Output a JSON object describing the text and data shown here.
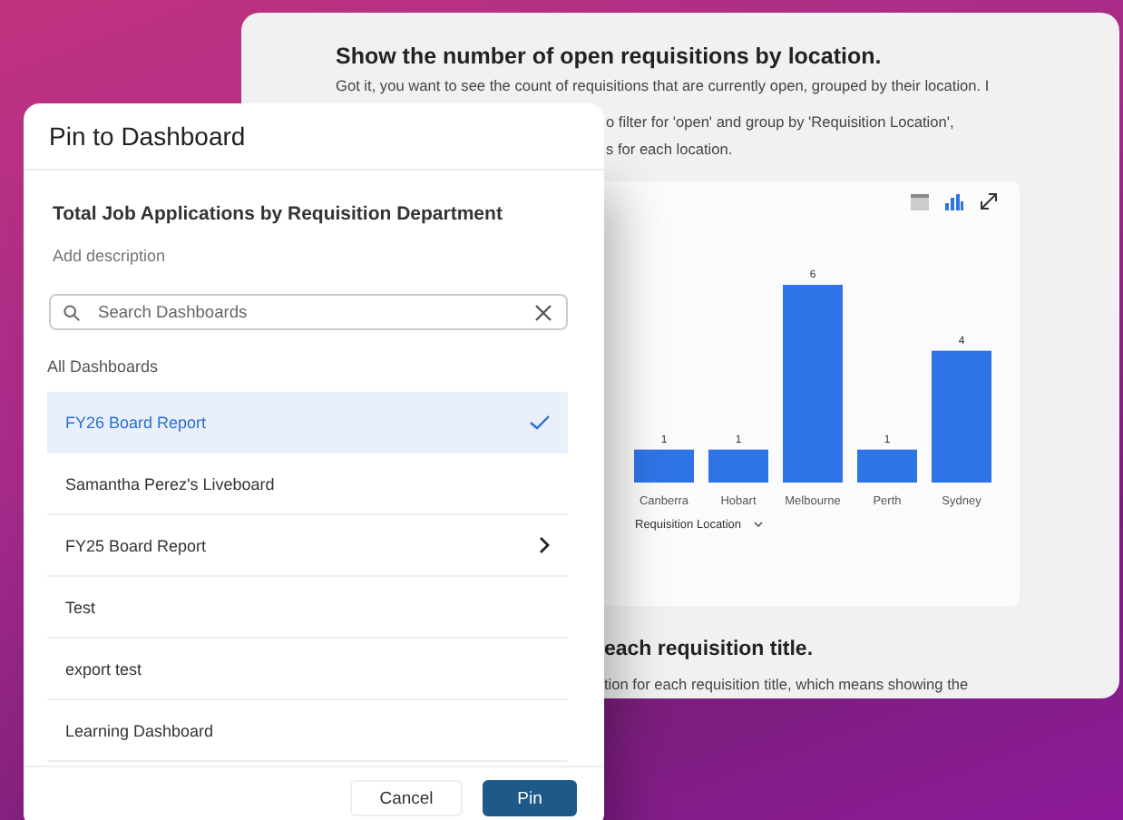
{
  "chat": {
    "question": "Show the number of open requisitions by location.",
    "answer_lines": [
      "Got it, you want to see the count of requisitions that are currently open, grouped by their location. I",
      "o filter for 'open' and group by 'Requisition Location',",
      "s for each location."
    ],
    "chart": {
      "chart_data": {
        "type": "bar",
        "xlabel": "Requisition Location",
        "categories": [
          "Canberra",
          "Hobart",
          "Melbourne",
          "Perth",
          "Sydney"
        ],
        "values": [
          1,
          1,
          6,
          1,
          4
        ],
        "data_labels": true
      }
    },
    "next_question": "each requisition title.",
    "next_answer": "tion for each requisition title, which means showing the"
  },
  "dialog": {
    "title": "Pin to Dashboard",
    "name": "Total Job Applications by Requisition Department",
    "description_placeholder": "Add description",
    "search": {
      "placeholder": "Search Dashboards"
    },
    "section_label": "All Dashboards",
    "items": [
      {
        "label": "FY26 Board Report",
        "selected": true,
        "expandable": false
      },
      {
        "label": "Samantha Perez's Liveboard",
        "selected": false,
        "expandable": false
      },
      {
        "label": "FY25 Board Report",
        "selected": false,
        "expandable": true
      },
      {
        "label": "Test",
        "selected": false,
        "expandable": false
      },
      {
        "label": "export test",
        "selected": false,
        "expandable": false
      },
      {
        "label": "Learning Dashboard",
        "selected": false,
        "expandable": false
      }
    ],
    "buttons": {
      "cancel": "Cancel",
      "confirm": "Pin"
    }
  }
}
